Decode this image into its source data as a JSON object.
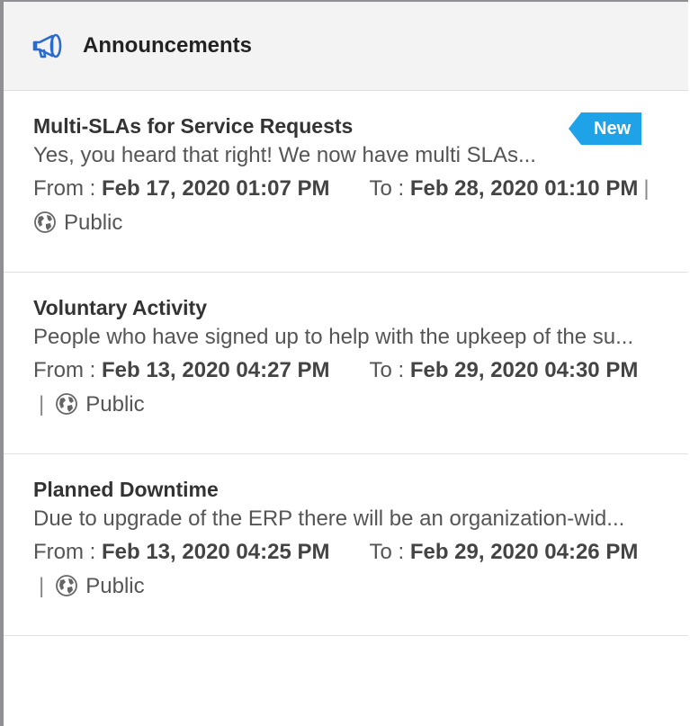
{
  "header": {
    "title": "Announcements",
    "icon": "megaphone-icon",
    "icon_color": "#2a6bd1"
  },
  "badge_color": "#1fa3e8",
  "announcements": [
    {
      "title": "Multi-SLAs for Service Requests",
      "description": "Yes, you heard that right! We now have multi SLAs...",
      "badge": "New",
      "from_label": "From :",
      "from": "Feb 17, 2020 01:07 PM",
      "to_label": "To :",
      "to": "Feb 28, 2020 01:10 PM",
      "separator": "|",
      "visibility": "Public"
    },
    {
      "title": "Voluntary Activity",
      "description": "People who have signed up to help with the upkeep of the su...",
      "from_label": "From :",
      "from": "Feb 13, 2020 04:27 PM",
      "to_label": "To :",
      "to": "Feb 29, 2020 04:30 PM",
      "separator": "|",
      "visibility": "Public"
    },
    {
      "title": "Planned Downtime",
      "description": "Due to upgrade of the ERP there will be an organization-wid...",
      "from_label": "From :",
      "from": "Feb 13, 2020 04:25 PM",
      "to_label": "To :",
      "to": "Feb 29, 2020 04:26 PM",
      "separator": "|",
      "visibility": "Public"
    }
  ]
}
